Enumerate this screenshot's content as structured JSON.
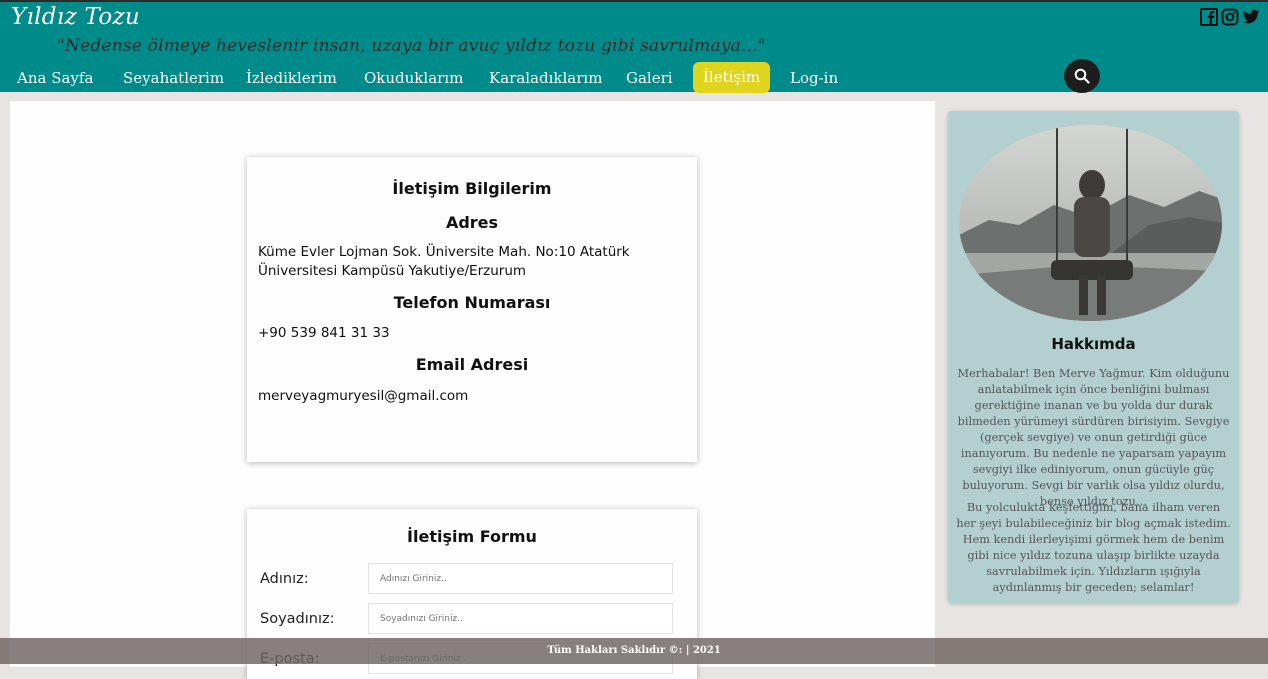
{
  "header": {
    "site_title": "Yıldız Tozu",
    "tagline": "\"Nedense ölmeye heveslenir insan, uzaya bir avuç yıldız tozu gibi savrulmaya...\"",
    "social_icons": [
      "facebook-icon",
      "instagram-icon",
      "twitter-icon"
    ],
    "colors": {
      "header_bg": "#008b8b",
      "active_tab": "#e0d51e"
    }
  },
  "nav": {
    "items": [
      "Ana Sayfa",
      "Seyahatlerim",
      "İzlediklerim",
      "Okuduklarım",
      "Karaladıklarım",
      "Galeri",
      "İletişim",
      "Log-in"
    ],
    "active": "İletişim",
    "search_icon": "search-icon"
  },
  "contact_info": {
    "title": "İletişim Bilgilerim",
    "address_heading": "Adres",
    "address": "Küme Evler Lojman Sok. Üniversite Mah. No:10 Atatürk Üniversitesi Kampüsü Yakutiye/Erzurum",
    "phone_heading": "Telefon Numarası",
    "phone": "+90 539 841 31 33",
    "email_heading": "Email Adresi",
    "email": "merveyagmuryesil@gmail.com"
  },
  "contact_form": {
    "title": "İletişim Formu",
    "fields": [
      {
        "label": "Adınız:",
        "placeholder": "Adınızı Giriniz.."
      },
      {
        "label": "Soyadınız:",
        "placeholder": "Soyadınızı Giriniz.."
      },
      {
        "label": "E-posta:",
        "placeholder": "E-postanızı Giriniz.."
      }
    ]
  },
  "sidebar": {
    "about_title": "Hakkımda",
    "about_p1": "Merhabalar! Ben Merve Yağmur. Kim olduğunu anlatabilmek için önce benliğini bulması gerektiğine inanan ve bu yolda dur durak bilmeden yürümeyi sürdüren birisiyim. Sevgiye (gerçek sevgiye) ve onun getirdiği güce inanıyorum. Bu nedenle ne yaparsam yapayım sevgiyi ilke ediniyorum, onun gücüyle güç buluyorum. Sevgi bir varlık olsa yıldız olurdu, bense yıldız tozu…",
    "about_p2": "Bu yolculukta keşfettiğim, bana ilham veren her şeyi bulabileceğiniz bir blog açmak istedim. Hem kendi ilerleyişimi görmek hem de benim gibi nice yıldız tozuna ulaşıp birlikte uzayda savrulabilmek için. Yıldızların ışığıyla aydınlanmış bir geceden; selamlar!"
  },
  "footer": {
    "text": "Tüm Hakları Saklıdır ©: | 2021"
  }
}
